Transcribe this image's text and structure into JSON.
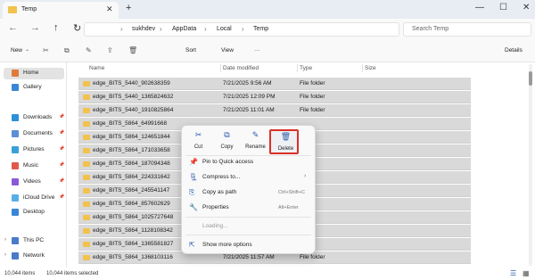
{
  "tab": {
    "title": "Temp",
    "close": "✕",
    "new": "+"
  },
  "window": {
    "minimize": "—",
    "maximize": "☐",
    "close": "✕"
  },
  "nav_buttons": {
    "back": "←",
    "forward": "→",
    "up": "↑",
    "refresh": "↻"
  },
  "breadcrumb": {
    "items": [
      "sukhdev",
      "AppData",
      "Local",
      "Temp"
    ],
    "separator": "›"
  },
  "search": {
    "placeholder": "Search Temp"
  },
  "toolbar": {
    "new": "New",
    "sort": "Sort",
    "view": "View",
    "more": "···",
    "details": "Details"
  },
  "sidebar": {
    "items": [
      {
        "label": "Home",
        "icon": "home-icon",
        "color": "#e07a3a"
      },
      {
        "label": "Gallery",
        "icon": "gallery-icon",
        "color": "#3a86d6"
      },
      {
        "label": "Downloads",
        "icon": "downloads-icon",
        "color": "#2f8fd8"
      },
      {
        "label": "Documents",
        "icon": "documents-icon",
        "color": "#5a8fd6"
      },
      {
        "label": "Pictures",
        "icon": "pictures-icon",
        "color": "#3aa0d8"
      },
      {
        "label": "Music",
        "icon": "music-icon",
        "color": "#e05a4a"
      },
      {
        "label": "Videos",
        "icon": "videos-icon",
        "color": "#8a5ad6"
      },
      {
        "label": "iCloud Drive",
        "icon": "icloud-icon",
        "color": "#5aaee8"
      },
      {
        "label": "Desktop",
        "icon": "desktop-icon",
        "color": "#3a86d6"
      },
      {
        "label": "This PC",
        "icon": "this-pc-icon",
        "color": "#4a7ac8"
      },
      {
        "label": "Network",
        "icon": "network-icon",
        "color": "#4a7ac8"
      }
    ]
  },
  "columns": {
    "name": "Name",
    "date": "Date modified",
    "type": "Type",
    "size": "Size"
  },
  "rows": [
    {
      "name": "edge_BITS_5440_902638359",
      "date": "7/21/2025 9:56 AM",
      "type": "File folder"
    },
    {
      "name": "edge_BITS_5440_1365824632",
      "date": "7/21/2025 12:09 PM",
      "type": "File folder"
    },
    {
      "name": "edge_BITS_5440_1910825864",
      "date": "7/21/2025 11:01 AM",
      "type": "File folder"
    },
    {
      "name": "edge_BITS_5864_64991668",
      "date": "",
      "type": ""
    },
    {
      "name": "edge_BITS_5864_124651844",
      "date": "",
      "type": ""
    },
    {
      "name": "edge_BITS_5864_171033658",
      "date": "",
      "type": ""
    },
    {
      "name": "edge_BITS_5864_187094348",
      "date": "",
      "type": ""
    },
    {
      "name": "edge_BITS_5864_224331642",
      "date": "",
      "type": ""
    },
    {
      "name": "edge_BITS_5864_245541147",
      "date": "",
      "type": ""
    },
    {
      "name": "edge_BITS_5864_857602629",
      "date": "",
      "type": ""
    },
    {
      "name": "edge_BITS_5864_1025727648",
      "date": "",
      "type": ""
    },
    {
      "name": "edge_BITS_5864_1128108342",
      "date": "",
      "type": ""
    },
    {
      "name": "edge_BITS_5864_1365581827",
      "date": "",
      "type": ""
    },
    {
      "name": "edge_BITS_5864_1368103116",
      "date": "7/21/2025 11:57 AM",
      "type": "File folder"
    }
  ],
  "context_menu": {
    "quick_actions": [
      {
        "label": "Cut",
        "icon": "✂"
      },
      {
        "label": "Copy",
        "icon": "⧉"
      },
      {
        "label": "Rename",
        "icon": "✎"
      },
      {
        "label": "Delete",
        "icon": "🗑"
      }
    ],
    "items": [
      {
        "label": "Pin to Quick access",
        "icon": "📌",
        "shortcut": "",
        "arrow": ""
      },
      {
        "label": "Compress to...",
        "icon": "🗜",
        "shortcut": "",
        "arrow": "›"
      },
      {
        "label": "Copy as path",
        "icon": "⎘",
        "shortcut": "Ctrl+Shift+C",
        "arrow": ""
      },
      {
        "label": "Properties",
        "icon": "🔧",
        "shortcut": "Alt+Enter",
        "arrow": ""
      }
    ],
    "loading": "Loading...",
    "more": {
      "label": "Show more options",
      "icon": "⇱"
    }
  },
  "status": {
    "count": "10,044 items",
    "selected": "10,044 items selected"
  }
}
